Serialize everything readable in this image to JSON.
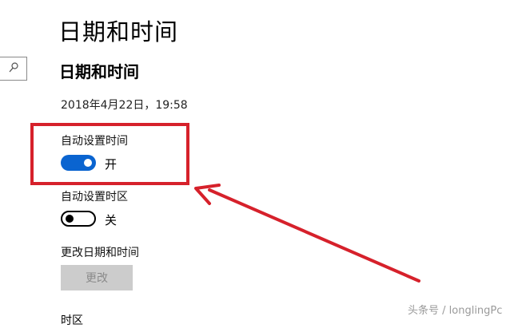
{
  "header": {
    "title": "日期和时间"
  },
  "section": {
    "title": "日期和时间"
  },
  "current_datetime": "2018年4月22日，19:58",
  "auto_time": {
    "label": "自动设置时间",
    "state": "开",
    "enabled": true
  },
  "auto_timezone": {
    "label": "自动设置时区",
    "state": "关",
    "enabled": false
  },
  "change_datetime": {
    "label": "更改日期和时间",
    "button_label": "更改"
  },
  "timezone_label": "时区",
  "watermark": "头条号 / longlingPc",
  "colors": {
    "accent": "#0a64d0",
    "annotation_red": "#d6212b",
    "disabled_button": "#cccccc"
  }
}
